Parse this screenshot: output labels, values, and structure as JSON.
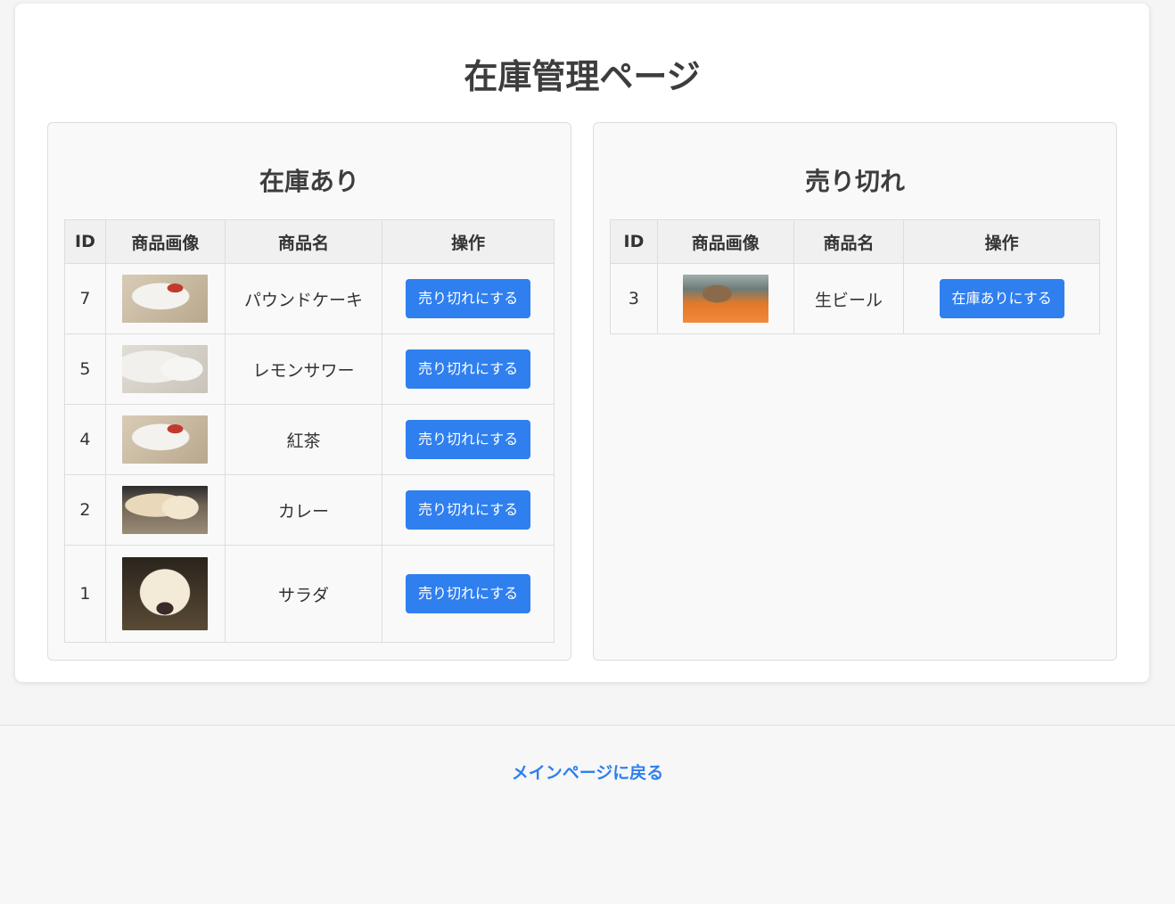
{
  "page": {
    "title": "在庫管理ページ"
  },
  "in_stock": {
    "title": "在庫あり",
    "headers": [
      "ID",
      "商品画像",
      "商品名",
      "操作"
    ],
    "rows": [
      {
        "id": "7",
        "name": "パウンドケーキ",
        "image": "white-cat-red-collar",
        "action": "売り切れにする"
      },
      {
        "id": "5",
        "name": "レモンサワー",
        "image": "white-cat",
        "action": "売り切れにする"
      },
      {
        "id": "4",
        "name": "紅茶",
        "image": "white-cat-red-collar",
        "action": "売り切れにする"
      },
      {
        "id": "2",
        "name": "カレー",
        "image": "dog-lying",
        "action": "売り切れにする"
      },
      {
        "id": "1",
        "name": "サラダ",
        "image": "dog-face",
        "action": "売り切れにする"
      }
    ]
  },
  "sold_out": {
    "title": "売り切れ",
    "headers": [
      "ID",
      "商品画像",
      "商品名",
      "操作"
    ],
    "rows": [
      {
        "id": "3",
        "name": "生ビール",
        "image": "tabby-cat",
        "action": "在庫ありにする"
      }
    ]
  },
  "footer": {
    "back_link": "メインページに戻る"
  },
  "colors": {
    "accent": "#2f7fef",
    "background": "#f5f5f5",
    "card": "#ffffff",
    "panel": "#f9f9f9",
    "header_cell": "#f0f0f0"
  }
}
